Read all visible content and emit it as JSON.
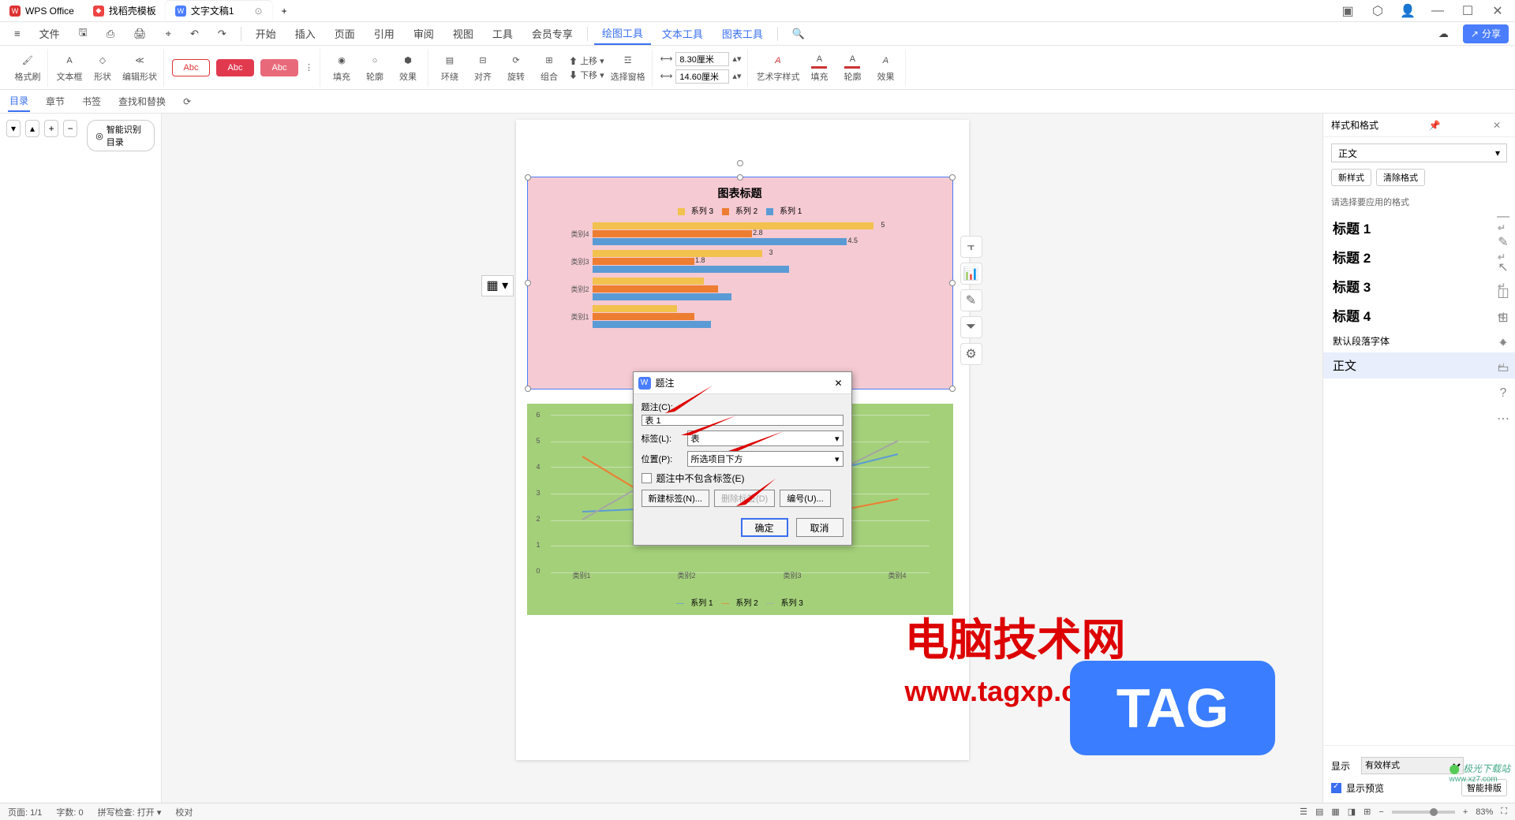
{
  "titlebar": {
    "tabs": [
      {
        "icon_bg": "#d33",
        "icon_txt": "W",
        "label": "WPS Office"
      },
      {
        "icon_bg": "#e44",
        "icon_txt": "◆",
        "label": "找稻壳模板"
      },
      {
        "icon_bg": "#4a7dff",
        "icon_txt": "W",
        "label": "文字文稿1"
      }
    ],
    "add_tab": "+"
  },
  "menubar": {
    "file": "文件",
    "items": [
      "开始",
      "插入",
      "页面",
      "引用",
      "审阅",
      "视图",
      "工具",
      "会员专享"
    ],
    "tool_tabs": [
      "绘图工具",
      "文本工具",
      "图表工具"
    ],
    "share": "分享"
  },
  "ribbon": {
    "format_painter": "格式刷",
    "textbox": "文本框",
    "shape": "形状",
    "editshape": "编辑形状",
    "presets": [
      "Abc",
      "Abc",
      "Abc"
    ],
    "fill": "填充",
    "outline": "轮廓",
    "effect": "效果",
    "wrap": "环绕",
    "align": "对齐",
    "rotate": "旋转",
    "group": "组合",
    "moveup": "上移",
    "movedown": "下移",
    "selpane": "选择窗格",
    "width_val": "8.30厘米",
    "height_val": "14.60厘米",
    "wordart": "艺术字样式",
    "tfill": "填充",
    "toutline": "轮廓",
    "teffect": "效果"
  },
  "secbar": {
    "toc": "目录",
    "chapter": "章节",
    "bookmark": "书签",
    "findreplace": "查找和替换",
    "smart_toc": "智能识别目录"
  },
  "chart_data": [
    {
      "type": "bar",
      "orientation": "horizontal",
      "title": "图表标题",
      "series_names": [
        "系列 3",
        "系列 2",
        "系列 1"
      ],
      "series_colors": [
        "#f2c14e",
        "#ed7d31",
        "#5b9bd5"
      ],
      "categories": [
        "类别4",
        "类别3",
        "类别2",
        "类别1"
      ],
      "values": {
        "系列 3": [
          5,
          3,
          2,
          null
        ],
        "系列 2": [
          2.8,
          1.8,
          null,
          null
        ],
        "系列 1": [
          4.5,
          null,
          null,
          null
        ]
      },
      "xlim": [
        0,
        6
      ]
    },
    {
      "type": "line",
      "series_names": [
        "系列 1",
        "系列 2",
        "系列 3"
      ],
      "series_colors": [
        "#5b9bd5",
        "#ed7d31",
        "#a5a5a5"
      ],
      "categories": [
        "类别1",
        "类别2",
        "类别3",
        "类别4"
      ],
      "values": {
        "系列 1": [
          2.3,
          2.5,
          3.5,
          4.5
        ],
        "系列 2": [
          4.4,
          2.0,
          2.0,
          2.8
        ],
        "系列 3": [
          2.0,
          4.3,
          3.0,
          5.0
        ]
      },
      "ylim": [
        0,
        6
      ],
      "yticks": [
        0,
        1,
        2,
        3,
        4,
        5,
        6
      ]
    }
  ],
  "dialog": {
    "title": "题注",
    "caption_label": "题注(C):",
    "caption_value": "表 1",
    "tag_label": "标签(L):",
    "tag_value": "表",
    "pos_label": "位置(P):",
    "pos_value": "所选项目下方",
    "exclude_label": "题注中不包含标签(E)",
    "new_tag": "新建标签(N)...",
    "del_tag": "删除标签(D)",
    "numbering": "编号(U)...",
    "ok": "确定",
    "cancel": "取消"
  },
  "rightpane": {
    "title": "样式和格式",
    "current": "正文",
    "new_style": "新样式",
    "clear_format": "清除格式",
    "hint": "请选择要应用的格式",
    "styles": [
      "标题 1",
      "标题 2",
      "标题 3",
      "标题 4",
      "默认段落字体",
      "正文"
    ],
    "show_label": "显示",
    "show_value": "有效样式",
    "preview_label": "显示预览",
    "smart_layout": "智能排版"
  },
  "statusbar": {
    "page": "页面: 1/1",
    "words": "字数: 0",
    "spell": "拼写检查: 打开",
    "proof": "校对",
    "zoom": "83%"
  },
  "overlay": {
    "brand": "电脑技术网",
    "url": "www.tagxp.com",
    "tag": "TAG",
    "wm1": "极光下载站",
    "wm2": "www.xz7.com"
  }
}
